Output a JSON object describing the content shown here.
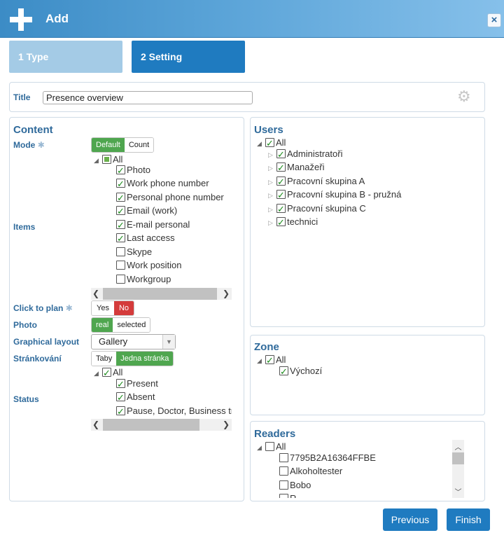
{
  "dialog": {
    "title": "Add"
  },
  "steps": [
    {
      "label": "1 Type"
    },
    {
      "label": "2 Setting"
    }
  ],
  "title_field": {
    "label": "Title",
    "value": "Presence overview"
  },
  "content": {
    "header": "Content",
    "mode": {
      "label": "Mode",
      "options": [
        "Default",
        "Count"
      ],
      "selected": "Default"
    },
    "items": {
      "label": "Items",
      "root": {
        "label": "All",
        "state": "partial"
      },
      "children": [
        {
          "label": "Photo",
          "checked": true
        },
        {
          "label": "Work phone number",
          "checked": true
        },
        {
          "label": "Personal phone number",
          "checked": true
        },
        {
          "label": "Email (work)",
          "checked": true
        },
        {
          "label": "E-mail personal",
          "checked": true
        },
        {
          "label": "Last access",
          "checked": true
        },
        {
          "label": "Skype",
          "checked": false
        },
        {
          "label": "Work position",
          "checked": false
        },
        {
          "label": "Workgroup",
          "checked": false
        }
      ]
    },
    "click_to_plan": {
      "label": "Click to plan",
      "options": [
        "Yes",
        "No"
      ],
      "selected": "No"
    },
    "photo": {
      "label": "Photo",
      "options": [
        "real",
        "selected"
      ],
      "selected": "real"
    },
    "graphical_layout": {
      "label": "Graphical layout",
      "value": "Gallery"
    },
    "strankovani": {
      "label": "Stránkování",
      "options": [
        "Taby",
        "Jedna stránka"
      ],
      "selected": "Jedna stránka"
    },
    "status": {
      "label": "Status",
      "root": {
        "label": "All",
        "state": "checked"
      },
      "children": [
        {
          "label": "Present",
          "checked": true
        },
        {
          "label": "Absent",
          "checked": true
        },
        {
          "label": "Pause, Doctor, Business trip",
          "checked": true
        }
      ]
    }
  },
  "users": {
    "header": "Users",
    "root": {
      "label": "All",
      "checked": true
    },
    "children": [
      {
        "label": "Administratoři",
        "checked": true
      },
      {
        "label": "Manažeři",
        "checked": true
      },
      {
        "label": "Pracovní skupina A",
        "checked": true
      },
      {
        "label": "Pracovní skupina B - pružná",
        "checked": true
      },
      {
        "label": "Pracovní skupina C",
        "checked": true
      },
      {
        "label": "technici",
        "checked": true
      }
    ]
  },
  "zone": {
    "header": "Zone",
    "root": {
      "label": "All",
      "checked": true
    },
    "children": [
      {
        "label": "Výchozí",
        "checked": true
      }
    ]
  },
  "readers": {
    "header": "Readers",
    "root": {
      "label": "All",
      "checked": false
    },
    "children": [
      {
        "label": "7795B2A16364FFBE",
        "checked": false
      },
      {
        "label": "Alkoholtester",
        "checked": false
      },
      {
        "label": "Bobo",
        "checked": false
      },
      {
        "label": "R",
        "checked": false
      }
    ]
  },
  "buttons": {
    "previous": "Previous",
    "finish": "Finish"
  },
  "icons": {
    "add": "plus-icon",
    "close": "close-icon",
    "settings": "gear-icon",
    "required": "asterisk-icon"
  },
  "colors": {
    "accent": "#1f7bc0",
    "active_toggle": "#4fa64f",
    "danger_toggle": "#d43b3b",
    "label": "#2f6a9b"
  }
}
